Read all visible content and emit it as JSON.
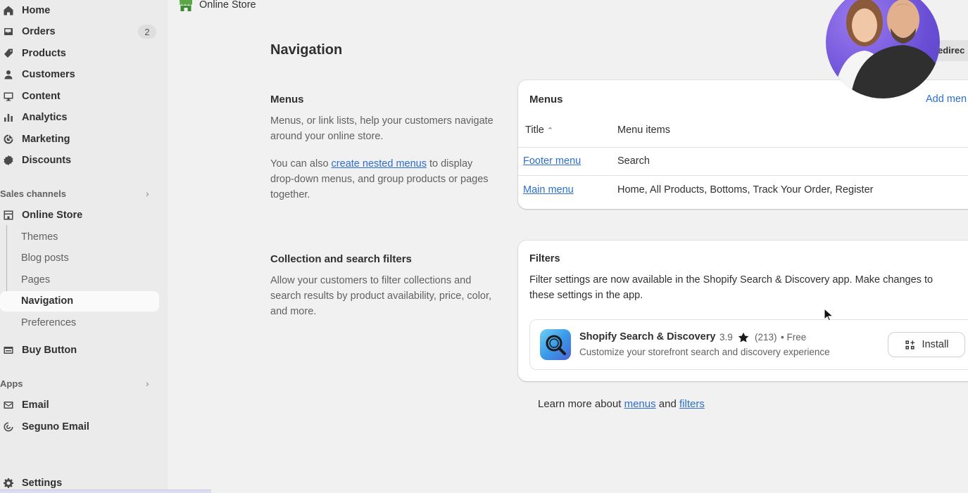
{
  "sidebar": {
    "items": [
      {
        "label": "Home",
        "icon": "home-icon"
      },
      {
        "label": "Orders",
        "icon": "orders-icon",
        "badge": "2"
      },
      {
        "label": "Products",
        "icon": "tag-icon"
      },
      {
        "label": "Customers",
        "icon": "person-icon"
      },
      {
        "label": "Content",
        "icon": "content-icon"
      },
      {
        "label": "Analytics",
        "icon": "bar-chart-icon"
      },
      {
        "label": "Marketing",
        "icon": "target-icon"
      },
      {
        "label": "Discounts",
        "icon": "discount-icon"
      }
    ],
    "sales_channels_label": "Sales channels",
    "online_store_label": "Online Store",
    "online_store_sub": [
      "Themes",
      "Blog posts",
      "Pages",
      "Navigation",
      "Preferences"
    ],
    "active_sub": "Navigation",
    "buy_button_label": "Buy Button",
    "apps_label": "Apps",
    "apps": [
      {
        "label": "Email",
        "icon": "email-icon"
      },
      {
        "label": "Seguno Email",
        "icon": "seguno-icon"
      }
    ],
    "settings_label": "Settings"
  },
  "topbar": {
    "title": "Online Store"
  },
  "page": {
    "title": "Navigation",
    "redirect_label": "edirec"
  },
  "menus_section": {
    "heading": "Menus",
    "desc1": "Menus, or link lists, help your customers navigate around your online store.",
    "desc2_prefix": "You can also ",
    "desc2_link": "create nested menus",
    "desc2_suffix": " to display drop-down menus, and group products or pages together.",
    "card_title": "Menus",
    "add_menu": "Add men",
    "col_title": "Title",
    "col_items": "Menu items",
    "rows": [
      {
        "title": "Footer menu",
        "items": "Search"
      },
      {
        "title": "Main menu",
        "items": "Home, All Products, Bottoms, Track Your Order, Register"
      }
    ]
  },
  "filters_section": {
    "heading": "Collection and search filters",
    "desc": "Allow your customers to filter collections and search results by product availability, price, color, and more.",
    "card_title": "Filters",
    "card_text": "Filter settings are now available in the Shopify Search & Discovery app. Make changes to these settings in the app.",
    "app": {
      "name": "Shopify Search & Discovery",
      "rating": "3.9",
      "reviews": "(213)",
      "price": "• Free",
      "desc": "Customize your storefront search and discovery experience",
      "install": "Install"
    }
  },
  "learn_more": {
    "prefix": "Learn more about ",
    "menus": "menus",
    "and": " and ",
    "filters": "filters"
  }
}
